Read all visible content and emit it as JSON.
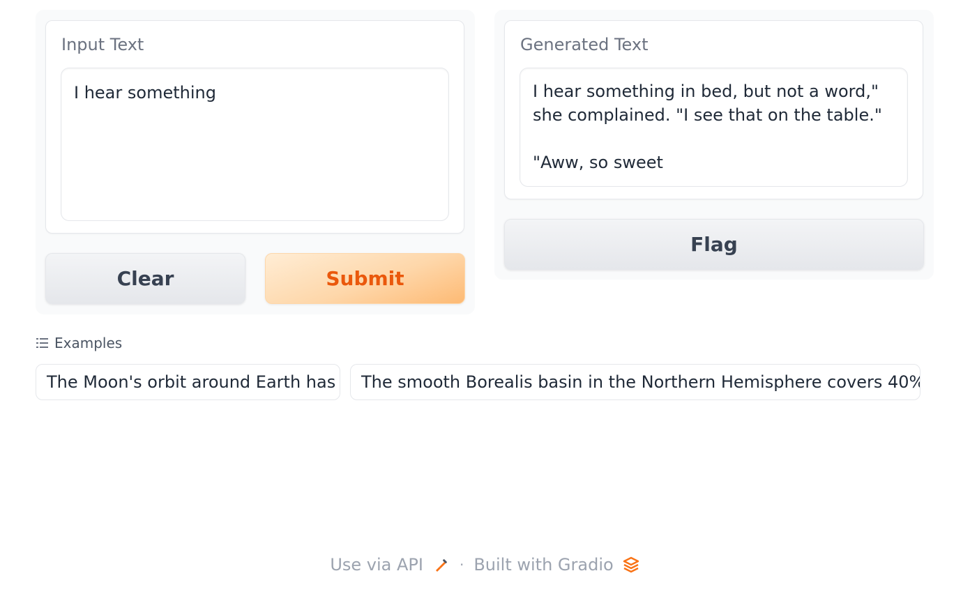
{
  "input_panel": {
    "label": "Input Text",
    "value": "I hear something",
    "clear_label": "Clear",
    "submit_label": "Submit"
  },
  "output_panel": {
    "label": "Generated Text",
    "value": "I hear something in bed, but not a word,\" she complained. \"I see that on the table.\"\n\n\"Aww, so sweet",
    "flag_label": "Flag"
  },
  "examples": {
    "header": "Examples",
    "items": [
      "The Moon's orbit around Earth has",
      "The smooth Borealis basin in the Northern Hemisphere covers 40%"
    ]
  },
  "footer": {
    "api_label": "Use via API",
    "separator": "·",
    "built_label": "Built with Gradio"
  },
  "colors": {
    "accent": "#ea580c",
    "primary_bg": "#fed7aa"
  },
  "icons": [
    "list-icon",
    "rocket-icon",
    "gradio-logo-icon"
  ]
}
